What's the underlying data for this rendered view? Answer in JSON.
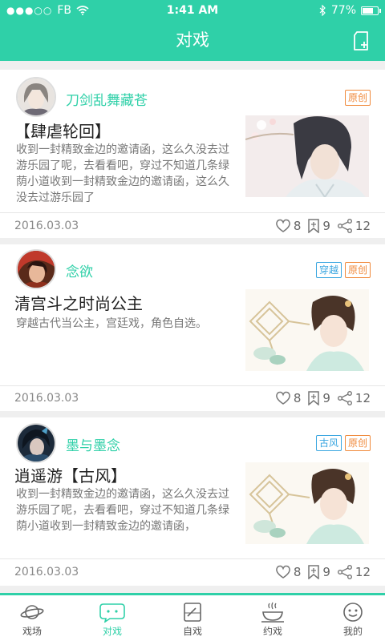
{
  "status": {
    "carrier": "FB",
    "time": "1:41 AM",
    "battery": "77%",
    "battery_level": 0.77
  },
  "header": {
    "title": "对戏"
  },
  "posts": [
    {
      "author": "刀剑乱舞藏苍",
      "tags": [
        {
          "label": "原创",
          "color": "orange"
        }
      ],
      "title": "【肆虐轮回】",
      "desc": "收到一封精致金边的邀请函，这么久没去过游乐园了呢，去看看吧，穿过不知道几条绿荫小道收到一封精致金边的邀请函，这么久没去过游乐园了",
      "date": "2016.03.03",
      "likes": "8",
      "saves": "9",
      "shares": "12"
    },
    {
      "author": "念欲",
      "tags": [
        {
          "label": "穿越",
          "color": "blue"
        },
        {
          "label": "原创",
          "color": "orange"
        }
      ],
      "title": "清宫斗之时尚公主",
      "desc": "穿越古代当公主，宫廷戏，角色自选。",
      "date": "2016.03.03",
      "likes": "8",
      "saves": "9",
      "shares": "12"
    },
    {
      "author": "墨与墨念",
      "tags": [
        {
          "label": "古风",
          "color": "blue"
        },
        {
          "label": "原创",
          "color": "orange"
        }
      ],
      "title": "逍遥游【古风】",
      "desc": "收到一封精致金边的邀请函，这么久没去过游乐园了呢，去看看吧，穿过不知道几条绿荫小道收到一封精致金边的邀请函，",
      "date": "2016.03.03",
      "likes": "8",
      "saves": "9",
      "shares": "12"
    }
  ],
  "tabs": [
    {
      "label": "戏场",
      "icon": "planet-icon",
      "active": false
    },
    {
      "label": "对戏",
      "icon": "chat-bubble-icon",
      "active": true
    },
    {
      "label": "自戏",
      "icon": "notebook-icon",
      "active": false
    },
    {
      "label": "约戏",
      "icon": "tea-cup-icon",
      "active": false
    },
    {
      "label": "我的",
      "icon": "smiley-icon",
      "active": false
    }
  ],
  "colors": {
    "accent": "#2fd0a8",
    "tag_orange": "#f08a3c",
    "tag_blue": "#3aa6e0"
  }
}
